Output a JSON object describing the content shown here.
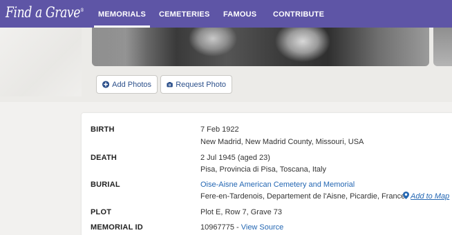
{
  "nav": {
    "logo": "Find a Grave",
    "logo_mark": "®",
    "items": [
      "MEMORIALS",
      "CEMETERIES",
      "FAMOUS",
      "CONTRIBUTE"
    ],
    "active": "MEMORIALS"
  },
  "photo_actions": {
    "add_photos": "Add Photos",
    "request_photo": "Request Photo"
  },
  "details": {
    "birth": {
      "label": "BIRTH",
      "date": "7 Feb 1922",
      "place": "New Madrid, New Madrid County, Missouri, USA"
    },
    "death": {
      "label": "DEATH",
      "date": "2 Jul 1945 (aged 23)",
      "place": "Pisa, Provincia di Pisa, Toscana, Italy"
    },
    "burial": {
      "label": "BURIAL",
      "cemetery": "Oise-Aisne American Cemetery and Memorial",
      "place": "Fere-en-Tardenois, Departement de l'Aisne, Picardie, France",
      "map_link": "Add to Map"
    },
    "plot": {
      "label": "PLOT",
      "value": "Plot E, Row 7, Grave 73"
    },
    "memorial_id": {
      "label": "MEMORIAL ID",
      "value": "10967775",
      "sep": " - ",
      "view_source": "View Source"
    }
  },
  "colors": {
    "nav_bg": "#5e55a6",
    "link": "#2467b3",
    "page_bg": "#f2f1ef"
  }
}
